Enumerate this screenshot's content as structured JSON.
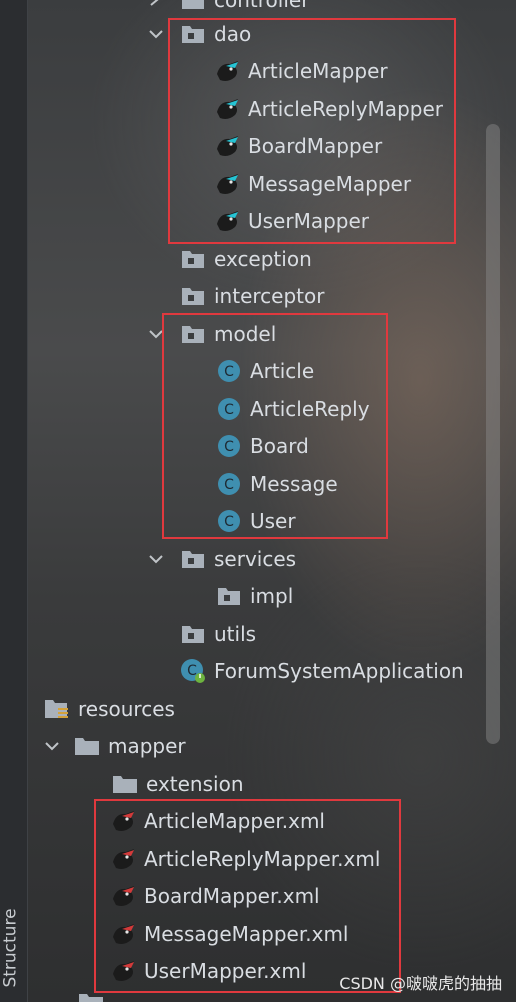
{
  "tree": {
    "top_partial": "controller",
    "dao": {
      "label": "dao",
      "items": [
        "ArticleMapper",
        "ArticleReplyMapper",
        "BoardMapper",
        "MessageMapper",
        "UserMapper"
      ]
    },
    "exception": "exception",
    "interceptor": "interceptor",
    "model": {
      "label": "model",
      "items": [
        "Article",
        "ArticleReply",
        "Board",
        "Message",
        "User"
      ]
    },
    "services": "services",
    "impl": "impl",
    "utils": "utils",
    "app_class": "ForumSystemApplication",
    "resources": "resources",
    "mapper": "mapper",
    "extension": "extension",
    "xml_files": [
      "ArticleMapper.xml",
      "ArticleReplyMapper.xml",
      "BoardMapper.xml",
      "MessageMapper.xml",
      "UserMapper.xml"
    ]
  },
  "side_tab": "Structure",
  "watermark": "CSDN @啵啵虎的抽抽",
  "colors": {
    "highlight": "#e0393e",
    "class_icon": "#3f8fb0",
    "folder_icon": "#a9b1ba",
    "mapper_icon_accent": "#25c3d3",
    "xml_icon_accent": "#d33a3a"
  },
  "icons": {
    "folder": "folder-icon",
    "class": "class-c-icon",
    "mapper": "mybatis-mapper-icon",
    "xml": "mybatis-xml-icon",
    "spring_app": "spring-boot-app-icon"
  }
}
